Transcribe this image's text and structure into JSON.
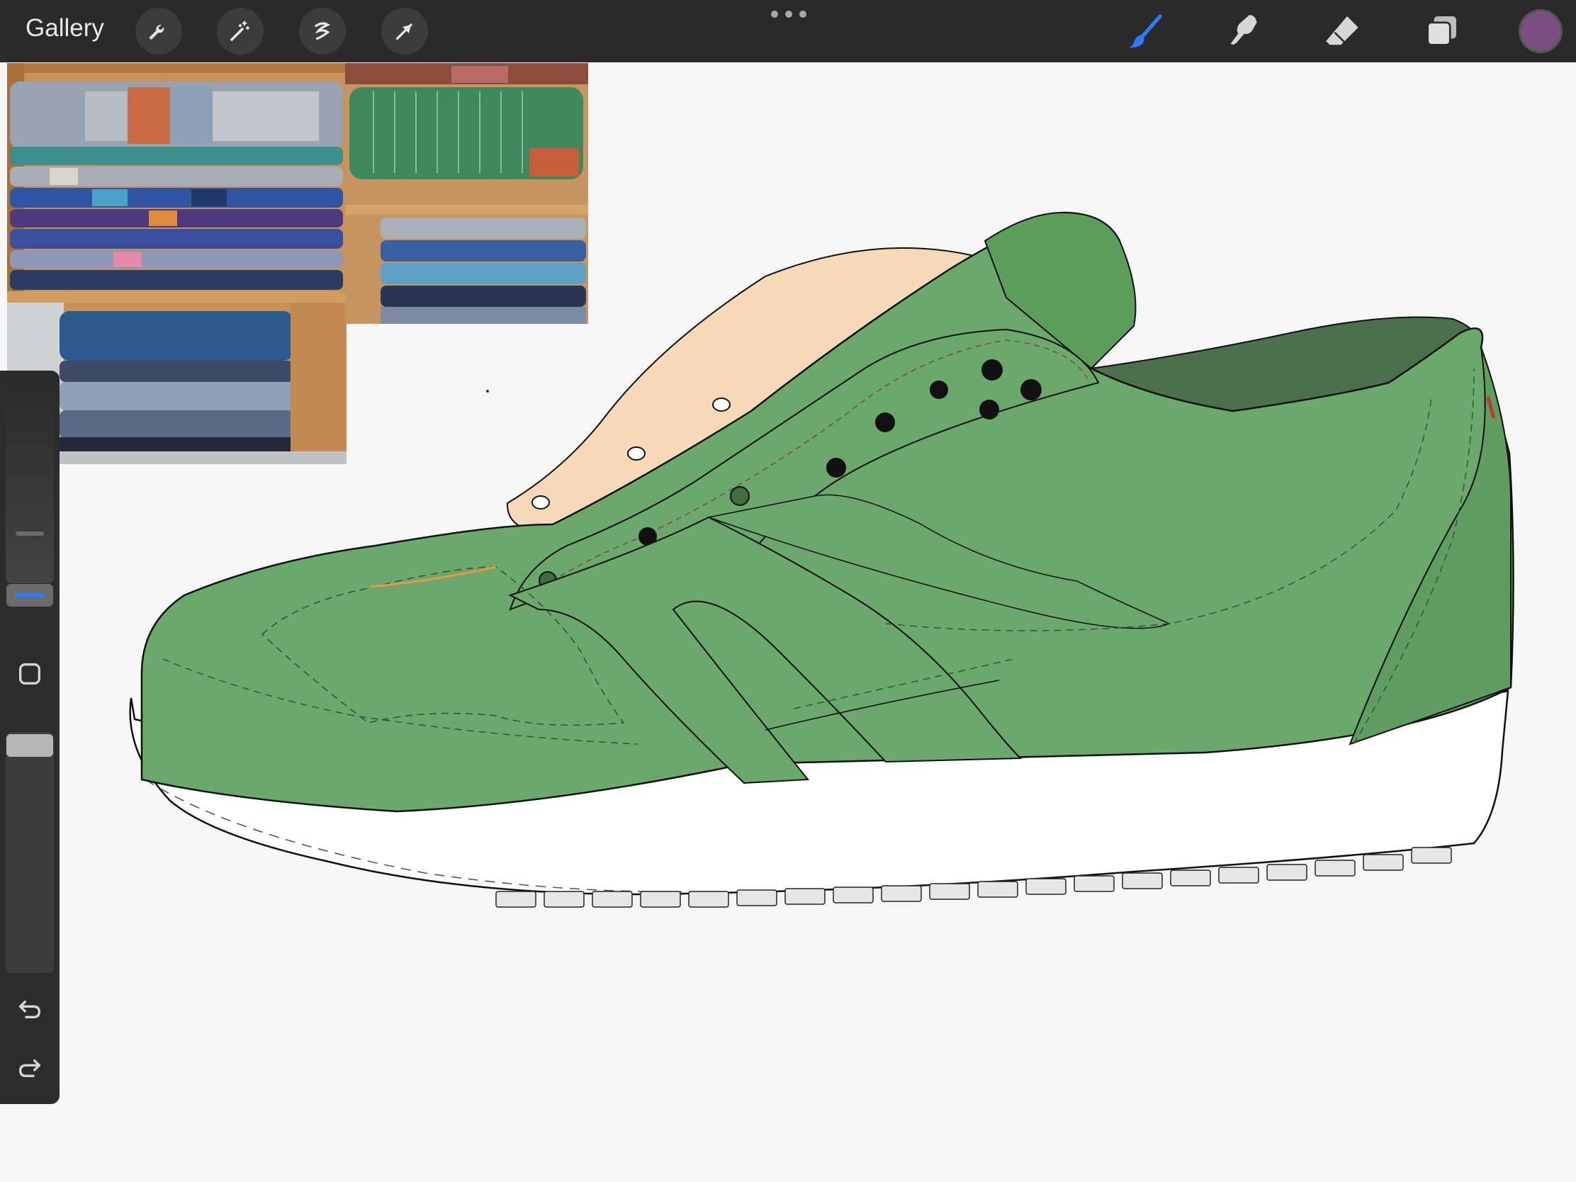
{
  "toolbar": {
    "gallery_label": "Gallery",
    "left_tools": [
      "wrench-icon",
      "magic-wand-icon",
      "selection-icon",
      "transform-arrow-icon"
    ],
    "right_tools": [
      "brush-icon",
      "smudge-icon",
      "eraser-icon",
      "layers-icon"
    ],
    "active_tool": "brush-icon",
    "active_color": "#7a4f80"
  },
  "sidebar": {
    "brush_size_level": 0.3,
    "opacity_level": 1.0,
    "icons": [
      "modify-square-icon",
      "undo-icon",
      "redo-icon"
    ]
  },
  "colors": {
    "toolbar_bg": "#2a2a2a",
    "canvas_bg": "#f6f6f6",
    "shoe_green": "#6aa86b",
    "shoe_dark_green": "#4c6f4c",
    "tongue_peach": "#f6d9b8",
    "accent_blue": "#2f7af6"
  },
  "canvas": {
    "reference_images": [
      "folded-blankets-photo",
      "green-blanket-photo"
    ],
    "drawing": "green-sneaker-sketch"
  }
}
